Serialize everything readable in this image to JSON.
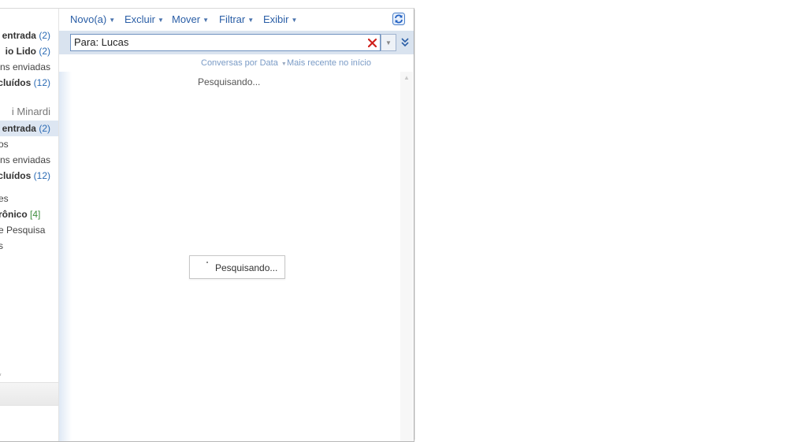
{
  "folders": {
    "account1": [
      {
        "name": "entrada",
        "count": "(2)",
        "bold": true
      },
      {
        "name": "io Lido",
        "count": "(2)",
        "bold": true
      },
      {
        "name": "ns enviadas",
        "count": "",
        "bold": false
      },
      {
        "name": "cluídos",
        "count": "(12)",
        "bold": true
      }
    ],
    "account2_label": "i Minardi",
    "account2": [
      {
        "name": "entrada",
        "count": "(2)",
        "bold": true
      },
      {
        "name": "os",
        "count": "",
        "bold": false
      },
      {
        "name": "ns enviadas",
        "count": "",
        "bold": false
      },
      {
        "name": "cluídos",
        "count": "(12)",
        "bold": true
      }
    ],
    "others": [
      {
        "name": "es",
        "count": ""
      },
      {
        "name": "rônico",
        "count": "[4]"
      },
      {
        "name": "e Pesquisa",
        "count": ""
      },
      {
        "name": "s",
        "count": ""
      }
    ],
    "bottom_mark": "*"
  },
  "toolbar": {
    "new_label": "Novo(a)",
    "delete_label": "Excluir",
    "move_label": "Mover",
    "filter_label": "Filtrar",
    "view_label": "Exibir"
  },
  "search": {
    "value": "Para: Lucas"
  },
  "sort": {
    "arrange_label": "Conversas por Data",
    "order_label": "Mais recente no início"
  },
  "status": {
    "top_text": "Pesquisando...",
    "loading_text": "Pesquisando..."
  },
  "icons": {
    "refresh": "refresh-icon",
    "clear": "clear-search-icon",
    "dropdown": "search-options-icon",
    "expand": "expand-icon"
  },
  "colors": {
    "accent": "#2a5ea6",
    "clear_red": "#d0211c",
    "search_bar_bg": "#d9e3ef"
  }
}
